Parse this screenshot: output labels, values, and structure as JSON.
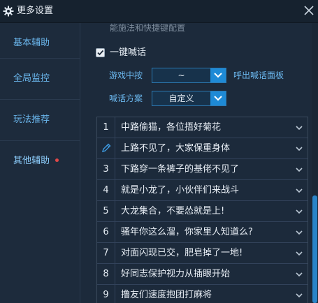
{
  "window": {
    "title": "更多设置"
  },
  "sidebar": {
    "items": [
      {
        "label": "基本辅助"
      },
      {
        "label": "全局监控"
      },
      {
        "label": "玩法推荐"
      },
      {
        "label": "其他辅助"
      }
    ]
  },
  "main": {
    "cut_text": "能施法和快捷键配置",
    "shout": {
      "checkbox_label": "一键喊话",
      "checked": true,
      "hotkey_label": "游戏中按",
      "hotkey_value": "~",
      "hotkey_suffix": "呼出喊话面板",
      "scheme_label": "喊话方案",
      "scheme_value": "自定义"
    },
    "messages": [
      {
        "num": "1",
        "text": "中路偷猫，各位捂好菊花"
      },
      {
        "num": "",
        "icon": "pencil-icon",
        "text": "上路不见了，大家保重身体"
      },
      {
        "num": "3",
        "text": "下路穿一条裤子的基佬不见了"
      },
      {
        "num": "4",
        "text": "就是小龙了，小伙伴们来战斗"
      },
      {
        "num": "5",
        "text": "大龙集合，不要怂就是上!"
      },
      {
        "num": "6",
        "text": "骚年你这么溜，你家里人知道么?"
      },
      {
        "num": "7",
        "text": "对面闪现已交，肥皂掉了一地!"
      },
      {
        "num": "8",
        "text": "好同志保护视力从插眼开始"
      },
      {
        "num": "9",
        "text": "撸友们速度抱团打麻将"
      }
    ]
  },
  "colors": {
    "accent": "#1e8ad6",
    "link": "#6ab6ec",
    "background": "#1c2a3b",
    "notify_dot": "#e04848"
  }
}
